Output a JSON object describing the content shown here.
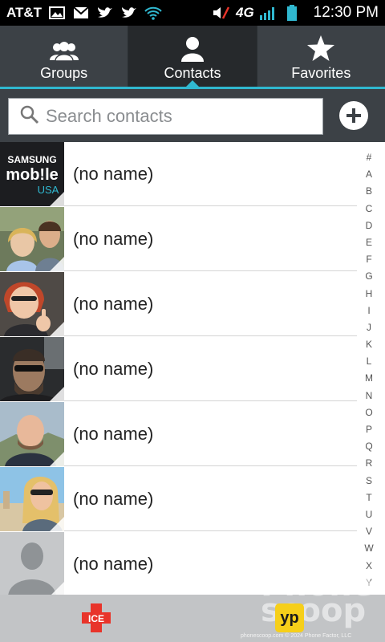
{
  "status_bar": {
    "carrier": "AT&T",
    "network": "4G",
    "time": "12:30 PM"
  },
  "tabs": [
    {
      "label": "Groups",
      "icon": "groups-icon",
      "active": false
    },
    {
      "label": "Contacts",
      "icon": "person-icon",
      "active": true
    },
    {
      "label": "Favorites",
      "icon": "star-icon",
      "active": false
    }
  ],
  "search": {
    "placeholder": "Search contacts",
    "value": ""
  },
  "contacts": [
    {
      "name": "(no name)",
      "photo": "samsung-mobile-usa-logo"
    },
    {
      "name": "(no name)",
      "photo": "couple-photo"
    },
    {
      "name": "(no name)",
      "photo": "woman-thumbs-up-photo"
    },
    {
      "name": "(no name)",
      "photo": "man-sunglasses-photo"
    },
    {
      "name": "(no name)",
      "photo": "bald-man-photo"
    },
    {
      "name": "(no name)",
      "photo": "woman-beach-photo"
    },
    {
      "name": "(no name)",
      "photo": "default-avatar"
    }
  ],
  "samsung_logo": {
    "line1": "SAMSUNG",
    "line2": "mob!le",
    "line3": "USA"
  },
  "index_letters": [
    "#",
    "A",
    "B",
    "C",
    "D",
    "E",
    "F",
    "G",
    "H",
    "I",
    "J",
    "K",
    "L",
    "M",
    "N",
    "O",
    "P",
    "Q",
    "R",
    "S",
    "T",
    "U",
    "V",
    "W",
    "X",
    "Y"
  ],
  "bottom_bar": {
    "ice_label": "ICE",
    "yp_label": "yp"
  },
  "watermark": {
    "text": "Phone scoop",
    "footer": "phonescoop.com  © 2024 Phone Factor, LLC"
  },
  "colors": {
    "accent": "#30b8d0",
    "tab_bg": "#3c4146",
    "active_tab_bg": "#26292c",
    "ice_red": "#e8342a",
    "yp_yellow": "#f6cf1a"
  }
}
